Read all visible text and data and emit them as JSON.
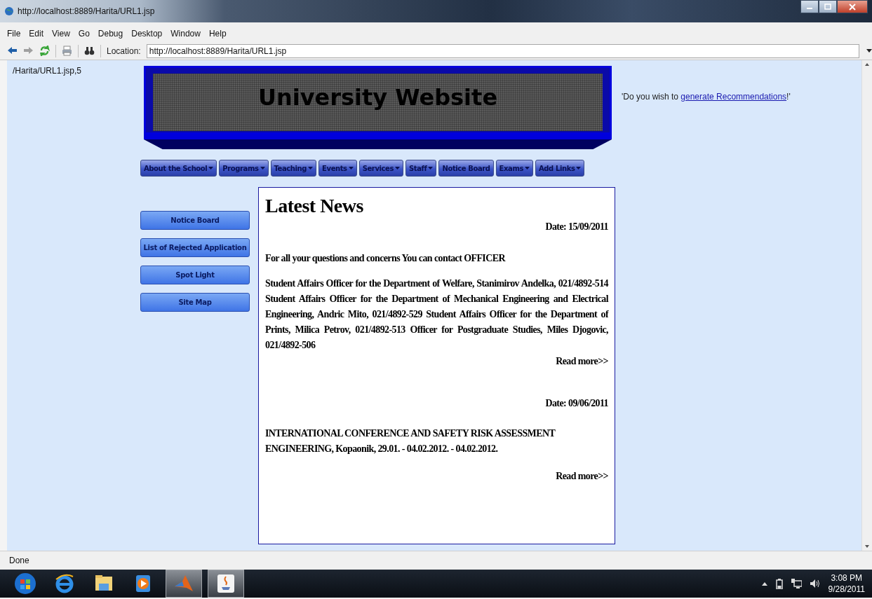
{
  "window": {
    "title": "http://localhost:8889/Harita/URL1.jsp"
  },
  "menu": [
    "File",
    "Edit",
    "View",
    "Go",
    "Debug",
    "Desktop",
    "Window",
    "Help"
  ],
  "toolbar": {
    "buttons": [
      {
        "kind": "back",
        "disabled": false
      },
      {
        "kind": "forward",
        "disabled": true
      },
      {
        "kind": "reload",
        "disabled": false
      },
      {
        "kind": "print",
        "disabled": false
      },
      {
        "kind": "find",
        "disabled": false
      }
    ],
    "location_label": "Location:",
    "location": "http://localhost:8889/Harita/URL1.jsp"
  },
  "page": {
    "path_text": "/Harita/URL1.jsp,5",
    "banner_title": "University Website",
    "nav": [
      {
        "label": "About the School",
        "dropdown": true
      },
      {
        "label": "Programs",
        "dropdown": true
      },
      {
        "label": "Teaching",
        "dropdown": true
      },
      {
        "label": "Events",
        "dropdown": true
      },
      {
        "label": "Services",
        "dropdown": true
      },
      {
        "label": "Staff",
        "dropdown": true
      },
      {
        "label": "Notice Board",
        "dropdown": false
      },
      {
        "label": "Exams",
        "dropdown": true
      },
      {
        "label": "Add Links",
        "dropdown": true
      }
    ],
    "sidebar": [
      "Notice Board",
      "List of Rejected Application",
      "Spot Light",
      "Site Map"
    ],
    "recommendation": {
      "before": "'Do you wish to ",
      "link": "generate Recommendations",
      "after": "!'"
    },
    "news": {
      "title": "Latest News",
      "items": [
        {
          "date": "Date: 15/09/2011",
          "heading": "For all your questions and concerns You can contact OFFICER",
          "body": "Student Affairs Officer for the Department of Welfare, Stanimirov Andelka, 021/4892-514 Student Affairs Officer for the Department of Mechanical Engineering and Electrical Engineering, Andric Mito, 021/4892-529 Student Affairs Officer for the Department of Prints, Milica Petrov, 021/4892-513 Officer for Postgraduate Studies, Miles Djogovic, 021/4892-506",
          "read_more": "Read more>>"
        },
        {
          "date": "Date: 09/06/2011",
          "heading": "INTERNATIONAL CONFERENCE AND SAFETY RISK ASSESSMENT ENGINEERING, Kopaonik, 29.01. - 04.02.2012. - 04.02.2012.",
          "read_more": "Read more>>"
        }
      ]
    }
  },
  "status_bar": "Done",
  "taskbar": {
    "apps": [
      {
        "kind": "start",
        "active": false
      },
      {
        "kind": "browser",
        "active": false
      },
      {
        "kind": "folder",
        "active": false
      },
      {
        "kind": "media",
        "active": false
      },
      {
        "kind": "matlab",
        "active": true
      },
      {
        "kind": "java",
        "active": true
      }
    ],
    "time": "3:08 PM",
    "date": "9/28/2011"
  }
}
